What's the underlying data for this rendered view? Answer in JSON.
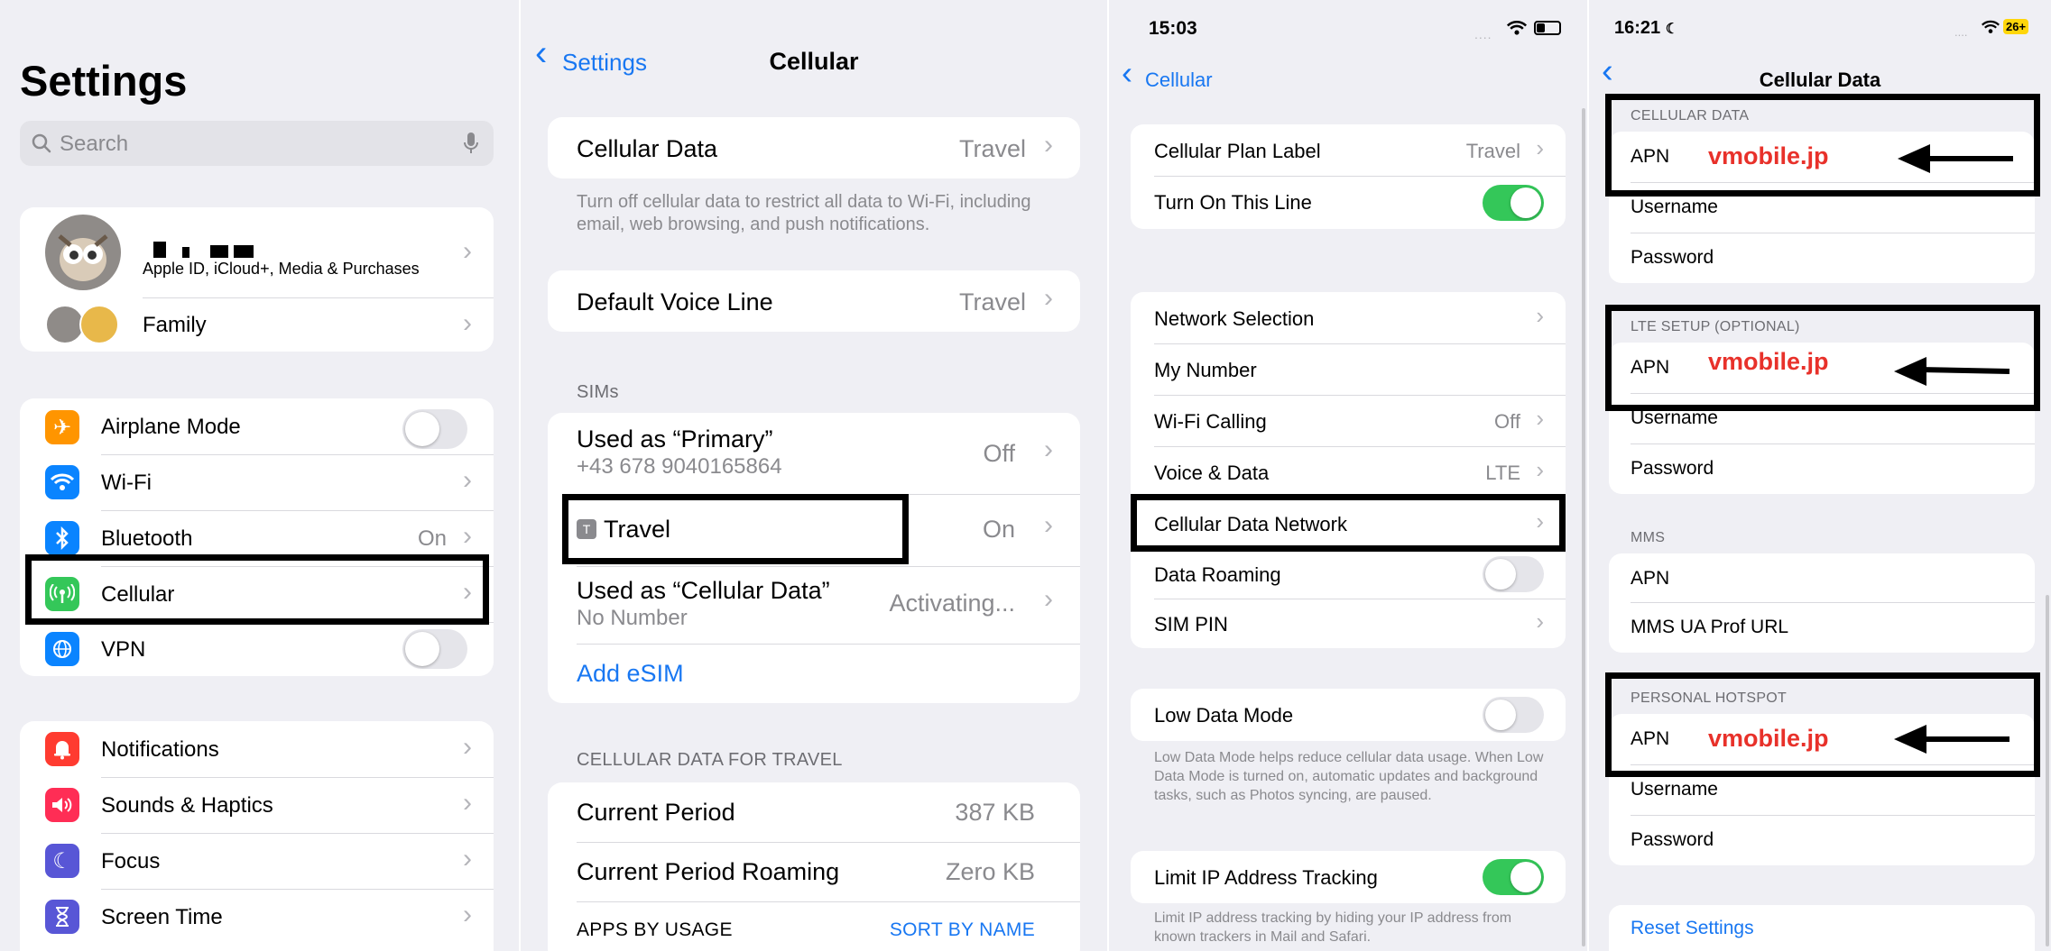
{
  "colors": {
    "accent": "#1877f2",
    "toggle_on": "#34c759",
    "toggle_off": "#e5e5ea",
    "annotation_red": "#e8312a",
    "highlight": "#000000"
  },
  "panel1": {
    "title": "Settings",
    "search_placeholder": "Search",
    "profile_sub": "Apple ID, iCloud+, Media & Purchases",
    "family": "Family",
    "connectivity": [
      {
        "label": "Airplane Mode",
        "icon": "airplane-icon",
        "color": "#ff9500",
        "toggle": "off"
      },
      {
        "label": "Wi-Fi",
        "icon": "wifi-icon",
        "color": "#0a84ff"
      },
      {
        "label": "Bluetooth",
        "icon": "bluetooth-icon",
        "color": "#0a84ff",
        "value": "On"
      },
      {
        "label": "Cellular",
        "icon": "cellular-icon",
        "color": "#34c759"
      },
      {
        "label": "VPN",
        "icon": "vpn-icon",
        "color": "#0a84ff",
        "toggle": "off"
      }
    ],
    "notifications": [
      {
        "label": "Notifications",
        "icon": "bell-icon",
        "color": "#ff3b30"
      },
      {
        "label": "Sounds & Haptics",
        "icon": "speaker-icon",
        "color": "#ff2d55"
      },
      {
        "label": "Focus",
        "icon": "moon-icon",
        "color": "#5856d6"
      },
      {
        "label": "Screen Time",
        "icon": "hourglass-icon",
        "color": "#5856d6"
      }
    ]
  },
  "panel2": {
    "back": "Settings",
    "title": "Cellular",
    "cellular_data": {
      "label": "Cellular Data",
      "value": "Travel"
    },
    "cellular_data_footer": "Turn off cellular data to restrict all data to Wi-Fi, including email, web browsing, and push notifications.",
    "default_voice": {
      "label": "Default Voice Line",
      "value": "Travel"
    },
    "sims_header": "SIMs",
    "primary": {
      "label": "Used as “Primary”",
      "number": "+43 678 9040165864",
      "value": "Off"
    },
    "travel": {
      "badge": "T",
      "label": "Travel",
      "value": "On"
    },
    "cell_data_line": {
      "label": "Used as “Cellular Data”",
      "sub": "No Number",
      "value": "Activating..."
    },
    "add_esim": "Add eSIM",
    "usage_header": "CELLULAR DATA FOR TRAVEL",
    "current_period": {
      "label": "Current Period",
      "value": "387 KB"
    },
    "current_roaming": {
      "label": "Current Period Roaming",
      "value": "Zero KB"
    },
    "apps_by_usage": "APPS BY USAGE",
    "sort_by_name": "SORT BY NAME"
  },
  "panel3": {
    "time": "15:03",
    "back": "Cellular",
    "plan_label": {
      "label": "Cellular Plan Label",
      "value": "Travel"
    },
    "turn_on_line": "Turn On This Line",
    "network_selection": "Network Selection",
    "my_number": "My Number",
    "wifi_calling": {
      "label": "Wi-Fi Calling",
      "value": "Off"
    },
    "voice_data": {
      "label": "Voice & Data",
      "value": "LTE"
    },
    "cellular_data_network": "Cellular Data Network",
    "data_roaming": "Data Roaming",
    "sim_pin": "SIM PIN",
    "low_data_mode": "Low Data Mode",
    "low_data_footer": "Low Data Mode helps reduce cellular data usage. When Low Data Mode is turned on, automatic updates and background tasks, such as Photos syncing, are paused.",
    "limit_ip": "Limit IP Address Tracking",
    "limit_ip_footer": "Limit IP address tracking by hiding your IP address from known trackers in Mail and Safari."
  },
  "panel4": {
    "time": "16:21",
    "battery": "26+",
    "title": "Cellular Data",
    "sections": {
      "cellular": "CELLULAR DATA",
      "lte": "LTE SETUP (OPTIONAL)",
      "mms": "MMS",
      "hotspot": "PERSONAL HOTSPOT"
    },
    "apn": "APN",
    "username": "Username",
    "password": "Password",
    "mms_ua": "MMS UA Prof URL",
    "apn_value": "vmobile.jp",
    "reset": "Reset Settings"
  }
}
